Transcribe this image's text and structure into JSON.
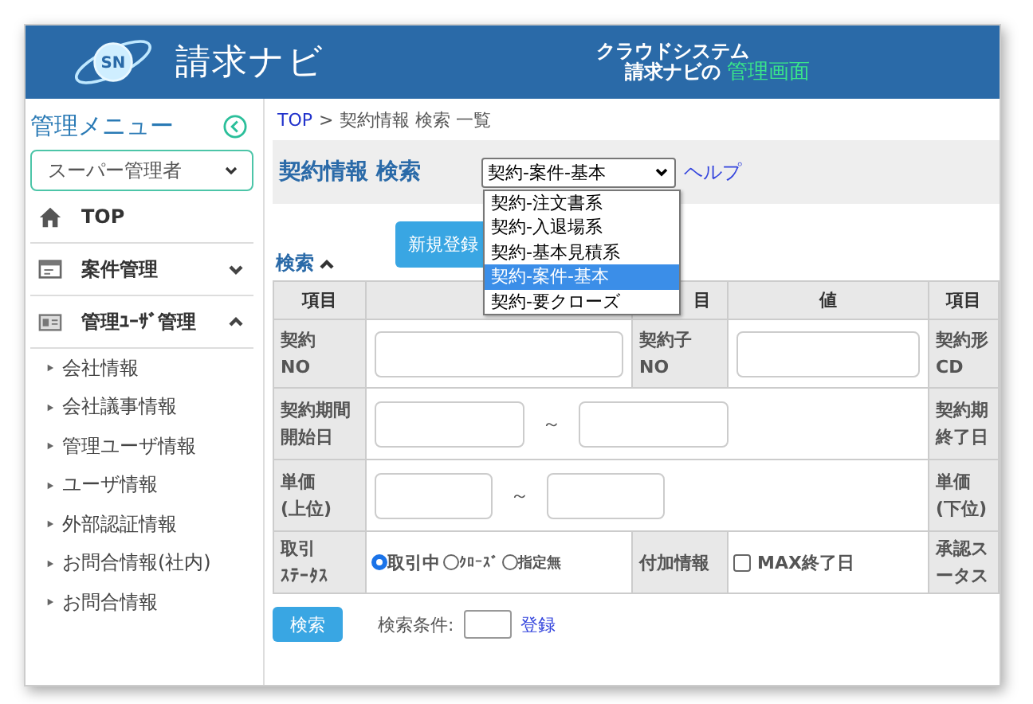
{
  "header": {
    "logo_text": "SN",
    "title": "請求ナビ",
    "tagline_top": "クラウドシステム",
    "tagline_prefix": "請求ナビの",
    "tagline_highlight": "管理画面"
  },
  "sidebar": {
    "title": "管理メニュー",
    "role_select": "スーパー管理者",
    "items": [
      {
        "label": "TOP",
        "kind": "link"
      },
      {
        "label": "案件管理",
        "kind": "group",
        "expanded": false
      },
      {
        "label": "管理ﾕｰｻﾞ管理",
        "kind": "group",
        "expanded": true,
        "children": [
          "会社情報",
          "会社議事情報",
          "管理ユーザ情報",
          "ユーザ情報",
          "外部認証情報",
          "お問合情報(社内)",
          "お問合情報"
        ]
      }
    ]
  },
  "breadcrumb": {
    "root": "TOP",
    "separator": ">",
    "current": "契約情報 検索 一覧"
  },
  "page_title": "契約情報 検索",
  "view_select": {
    "value": "契約-案件-基本",
    "open": true,
    "options": [
      {
        "label": "契約-注文書系",
        "selected": false
      },
      {
        "label": "契約-入退場系",
        "selected": false
      },
      {
        "label": "契約-基本見積系",
        "selected": false
      },
      {
        "label": "契約-案件-基本",
        "selected": true
      },
      {
        "label": "契約-要クローズ",
        "selected": false
      }
    ]
  },
  "help_link": "ヘルプ",
  "new_button": "新規登録",
  "search_toggle": {
    "label": "検索",
    "expanded": true
  },
  "table": {
    "header": [
      {
        "label": "項目"
      },
      {
        "label": "目"
      },
      {
        "label": "値"
      },
      {
        "label": "項目"
      }
    ],
    "rows": [
      [
        {
          "kind": "label",
          "lines": [
            "契約",
            "NO"
          ]
        },
        {
          "kind": "input"
        },
        {
          "kind": "label",
          "lines": [
            "契約子",
            "NO"
          ]
        },
        {
          "kind": "input"
        },
        {
          "kind": "label",
          "lines": [
            "契約形",
            "CD"
          ]
        }
      ],
      [
        {
          "kind": "label",
          "lines": [
            "契約期間",
            "開始日"
          ]
        },
        {
          "kind": "range",
          "colspan": 3,
          "separator": "～"
        },
        {
          "kind": "label",
          "lines": [
            "契約期",
            "終了日"
          ]
        }
      ],
      [
        {
          "kind": "label",
          "lines": [
            "単価",
            "(上位)"
          ]
        },
        {
          "kind": "range",
          "colspan": 3,
          "separator": "～"
        },
        {
          "kind": "label",
          "lines": [
            "単価",
            "(下位)"
          ]
        }
      ],
      [
        {
          "kind": "label",
          "lines": [
            "取引",
            "ｽﾃｰﾀｽ"
          ]
        },
        {
          "kind": "radios",
          "options": [
            {
              "label": "取引中",
              "selected": true
            },
            {
              "label": "ｸﾛｰｽﾞ",
              "selected": false
            },
            {
              "label": "指定無",
              "selected": false
            }
          ]
        },
        {
          "kind": "label",
          "lines": [
            "付加情報"
          ]
        },
        {
          "kind": "checkbox",
          "label": "MAX終了日",
          "checked": false
        },
        {
          "kind": "label",
          "lines": [
            "承認ス",
            "ータス"
          ]
        }
      ]
    ]
  },
  "footer": {
    "search_button": "検索",
    "condition_label": "検索条件:",
    "register_link": "登録"
  }
}
